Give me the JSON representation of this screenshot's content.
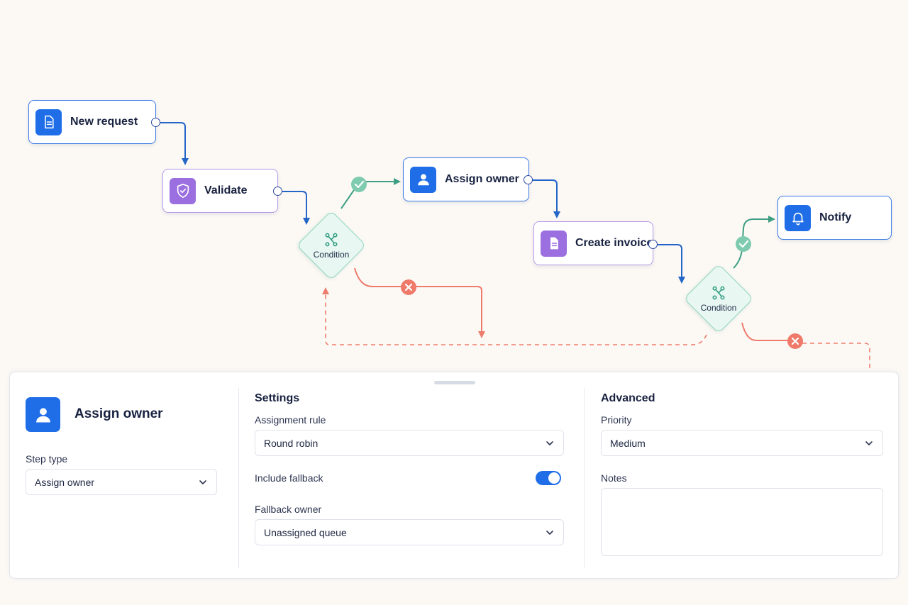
{
  "workflow": {
    "nodes": [
      {
        "label": "New request",
        "icon": "document-icon",
        "color": "#1f6ee8"
      },
      {
        "label": "Validate",
        "icon": "shield-check-icon",
        "color": "#9b6fe0"
      },
      {
        "label": "Assign owner",
        "icon": "user-icon",
        "color": "#1f6ee8"
      },
      {
        "label": "Create invoice",
        "icon": "document-icon",
        "color": "#9b6fe0"
      },
      {
        "label": "Notify",
        "icon": "bell-icon",
        "color": "#1f6ee8"
      }
    ],
    "conditions": [
      {
        "label": "Condition",
        "icon": "branch-icon"
      },
      {
        "label": "Condition",
        "icon": "branch-icon"
      }
    ],
    "edge_colors": {
      "flow": "#2466c8",
      "success": "#3f9e83",
      "failure": "#ee7c6c"
    }
  },
  "panel": {
    "step": {
      "title": "Assign owner",
      "icon": "user-icon",
      "step_type_label": "Step type",
      "step_type_value": "Assign owner"
    },
    "settings": {
      "title": "Settings",
      "assignment_rule_label": "Assignment rule",
      "assignment_rule_value": "Round robin",
      "include_fallback_label": "Include fallback",
      "include_fallback_on": true,
      "fallback_owner_label": "Fallback owner",
      "fallback_owner_value": "Unassigned queue"
    },
    "advanced": {
      "title": "Advanced",
      "priority_label": "Priority",
      "priority_value": "Medium",
      "notes_label": "Notes",
      "notes_value": ""
    }
  }
}
